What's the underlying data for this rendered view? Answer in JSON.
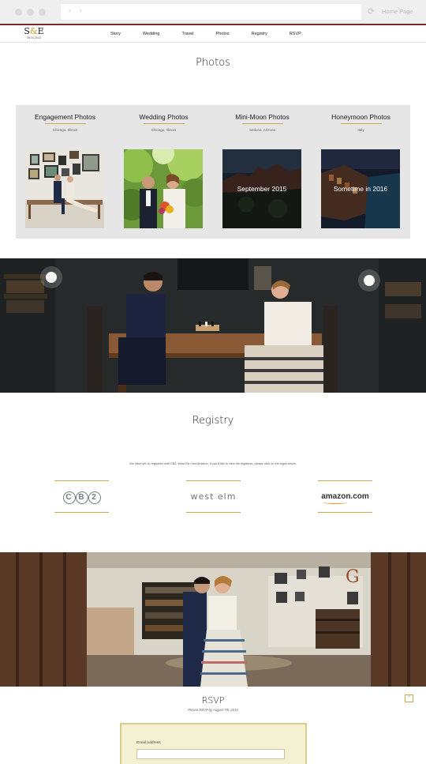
{
  "browser": {
    "nav_arrows": "‹ ›",
    "home_label": "Home Page"
  },
  "site": {
    "logo_left": "S",
    "logo_amp": "&",
    "logo_right": "E",
    "logo_date": "09.04.2015",
    "nav": [
      "Story",
      "Wedding",
      "Travel",
      "Photos",
      "Registry",
      "RSVP"
    ]
  },
  "photos": {
    "title": "Photos",
    "albums": [
      {
        "title": "Engagement Photos",
        "location": "Chicago, Illinois",
        "overlay": ""
      },
      {
        "title": "Wedding Photos",
        "location": "Chicago, Illinois",
        "overlay": ""
      },
      {
        "title": "Mini-Moon Photos",
        "location": "Sedona, Arizona",
        "overlay": "September 2015"
      },
      {
        "title": "Honeymoon Photos",
        "location": "Italy",
        "overlay": "Sometime in 2016"
      }
    ]
  },
  "registry": {
    "title": "Registry",
    "text": "We have set up registries with CB2, West Elm and Amazon. If you'd like to view the registries, please click on the logos below.",
    "logos": {
      "cb2_c": "C",
      "cb2_b": "B",
      "cb2_2": "2",
      "westelm": "west elm",
      "amazon": "amazon.com"
    }
  },
  "rsvp": {
    "title": "RSVP",
    "subtitle": "Please RSVP by August 7th, 2015",
    "back_to_top": "^",
    "email_label": "Email Address",
    "email_value": ""
  }
}
